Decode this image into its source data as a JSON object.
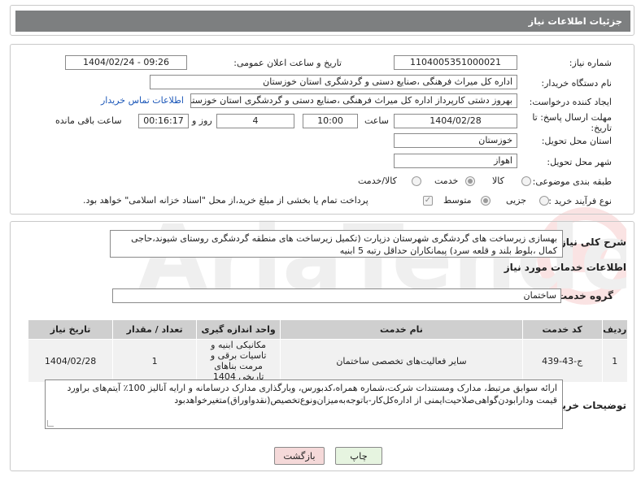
{
  "header": {
    "title": "جزئیات اطلاعات نیاز"
  },
  "form": {
    "need_number_label": "شماره نیاز:",
    "need_number": "1104005351000021",
    "announce_label": "تاریخ و ساعت اعلان عمومی:",
    "announce_value": "1404/02/24 - 09:26",
    "buyer_org_label": "نام دستگاه خریدار:",
    "buyer_org": "اداره کل میراث فرهنگی ،صنایع دستی و گردشگری استان خوزستان",
    "creator_label": "ایجاد کننده درخواست:",
    "creator": "بهروز دشتی کارپرداز اداره کل میراث فرهنگی ،صنایع دستی و گردشگری استان خوزستان",
    "contact_link": "اطلاعات تماس خریدار",
    "deadline_label": "مهلت ارسال پاسخ: تا تاریخ:",
    "deadline_date": "1404/02/28",
    "time_label": "ساعت",
    "deadline_time": "10:00",
    "days_value": "4",
    "days_label": "روز و",
    "remaining_time": "00:16:17",
    "remaining_label": "ساعت باقی مانده",
    "province_label": "استان محل تحویل:",
    "province": "خوزستان",
    "city_label": "شهر محل تحویل:",
    "city": "اهواز",
    "category_label": "طبقه بندی موضوعی:",
    "category_options": [
      "کالا",
      "خدمت",
      "کالا/خدمت"
    ],
    "category_selected": "خدمت",
    "process_label": "نوع فرآیند خرید :",
    "process_options": [
      "جزیی",
      "متوسط"
    ],
    "process_selected": "متوسط",
    "payment_note": "پرداخت تمام یا بخشی از مبلغ خرید،از محل \"اسناد خزانه اسلامی\" خواهد بود."
  },
  "summary": {
    "label": "شرح کلی نیاز:",
    "text": "بهسازی زیرساخت های گردشگری شهرستان دزپارت (تکمیل زیرساخت های منطقه گردشگری روستای شیوند،حاجی کمال ،بلوط بلند و قلعه سرد) پیمانکاران حداقل رتبه 5 ابنیه"
  },
  "services": {
    "section_title": "اطلاعات خدمات مورد نیاز",
    "group_label": "گروه خدمت:",
    "group_value": "ساختمان",
    "columns": [
      "ردیف",
      "کد خدمت",
      "نام خدمت",
      "واحد اندازه گیری",
      "تعداد / مقدار",
      "تاریخ نیاز"
    ],
    "rows": [
      {
        "index": "1",
        "code": "ج-43-439",
        "name": "سایر فعالیت‌های تخصصی ساختمان",
        "unit": "مکانیکی ابنیه و تاسیات برقی و مرمت بناهای تاریخی 1404",
        "qty": "1",
        "date": "1404/02/28"
      }
    ]
  },
  "buyer_notes": {
    "label": "توضیحات خریدار:",
    "text": "ارائه سوابق مرتبط، مدارک ومستندات شرکت،شماره همراه،کدبورس، وبارگذاری مدارک درسامانه و ارایه آنالیز 100٪ آیتم‌های براورد قیمت ودارابودن‌گواهی‌صلاحیت‌ایمنی از اداره‌کل‌کار-باتوجه‌به‌میزان‌ونوع‌تخصیص(نقدواوراق)متغیرخواهدبود"
  },
  "buttons": {
    "back": "بازگشت",
    "print": "چاپ"
  },
  "colors": {
    "header_bg": "#7d7f80",
    "link": "#1a56b8",
    "back_bg": "#f5d9d9",
    "print_bg": "#e6f4e0"
  }
}
